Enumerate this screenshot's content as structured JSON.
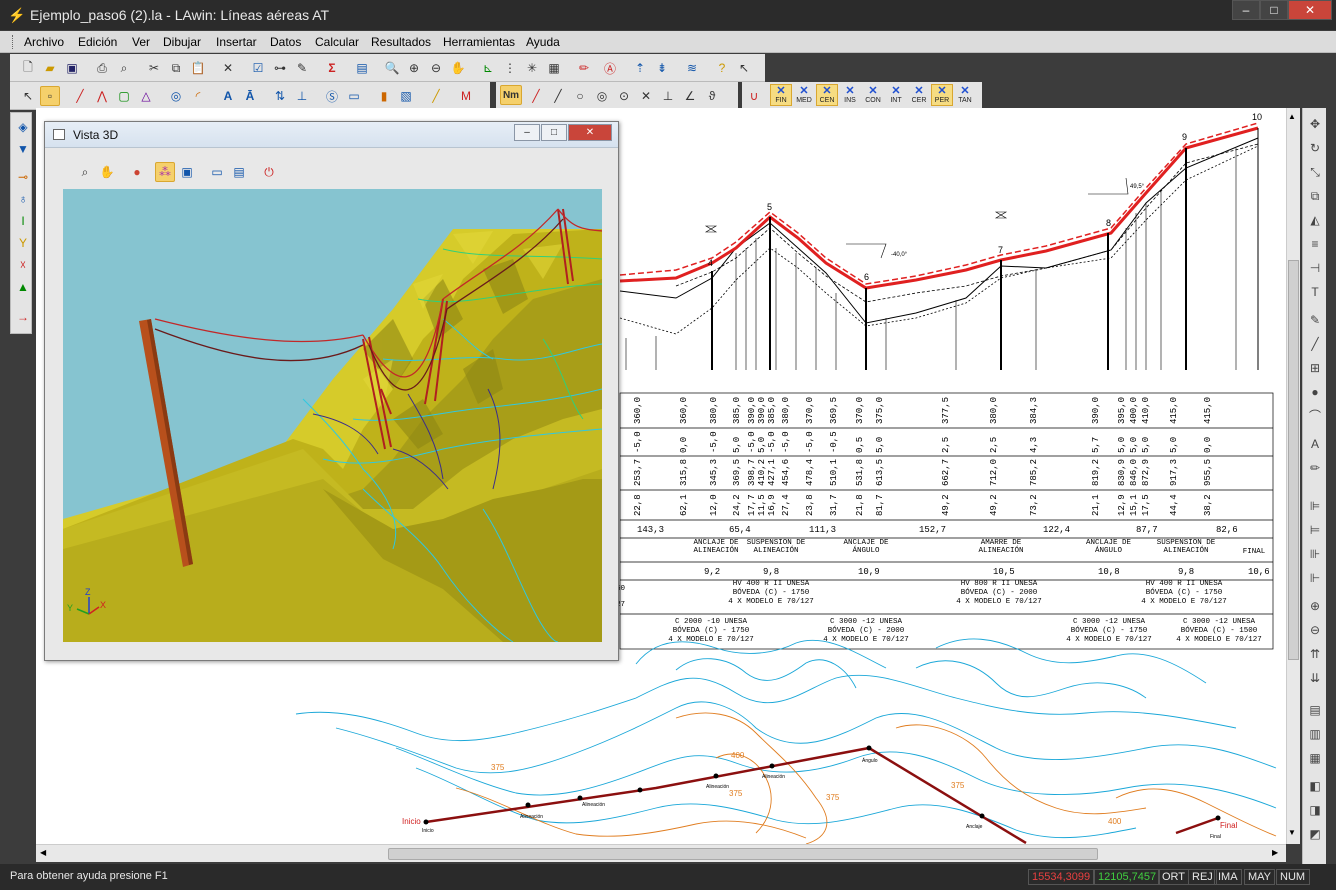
{
  "window": {
    "title": "Ejemplo_paso6 (2).la - LAwin: Líneas aéreas AT",
    "icon": "tower-icon",
    "controls": {
      "minimize": "–",
      "maximize": "□",
      "close": "✕"
    }
  },
  "menu": [
    "Archivo",
    "Edición",
    "Ver",
    "Dibujar",
    "Insertar",
    "Datos",
    "Calcular",
    "Resultados",
    "Herramientas",
    "Ayuda"
  ],
  "snap_toolbar": [
    {
      "label": "FIN",
      "active": true
    },
    {
      "label": "MED",
      "active": false
    },
    {
      "label": "CEN",
      "active": true
    },
    {
      "label": "INS",
      "active": false
    },
    {
      "label": "CON",
      "active": false
    },
    {
      "label": "INT",
      "active": false
    },
    {
      "label": "CER",
      "active": false
    },
    {
      "label": "PER",
      "active": true
    },
    {
      "label": "TAN",
      "active": false
    }
  ],
  "snap_mode_label": "Nm",
  "view3d": {
    "title": "Vista 3D",
    "axes": {
      "z": "Z",
      "y": "Y",
      "x": "X"
    },
    "colors": {
      "sky": "#86c4d0",
      "terrain": "#c8bc1e",
      "pole": "#b8501c",
      "conductor": "#d03030"
    }
  },
  "profile": {
    "support_numbers": [
      "4",
      "5",
      "6",
      "7",
      "8",
      "9",
      "10"
    ],
    "angle_labels": [
      "-40,0°",
      "49,5°"
    ],
    "table_row1": [
      "360,0",
      "360,0",
      "380,0",
      "385,0",
      "390,0",
      "390,0",
      "385,0",
      "380,0",
      "370,0",
      "369,5",
      "370,0",
      "375,0",
      "377,5",
      "380,0",
      "384,3",
      "390,0",
      "395,0",
      "400,0",
      "410,0",
      "415,0",
      "415,0"
    ],
    "table_row2": [
      "-5,0",
      "0,0",
      "-5,0",
      "5,0",
      "-5,0",
      "5,0",
      "-5,0",
      "-5,0",
      "-5,0",
      "-0,5",
      "0,5",
      "5,0",
      "2,5",
      "2,5",
      "4,3",
      "5,7",
      "5,0",
      "5,0",
      "5,0",
      "5,0",
      "0,0"
    ],
    "table_row3": [
      "253,7",
      "315,8",
      "345,3",
      "369,5",
      "398,7",
      "410,2",
      "427,1",
      "454,6",
      "478,4",
      "510,1",
      "531,8",
      "613,5",
      "662,7",
      "712,0",
      "785,2",
      "819,2",
      "830,9",
      "846,0",
      "872,9",
      "917,3",
      "955,5"
    ],
    "table_row4": [
      "22,8",
      "62,1",
      "12,0",
      "24,2",
      "17,7",
      "11,5",
      "16,9",
      "27,4",
      "23,8",
      "31,7",
      "21,8",
      "81,7",
      "49,2",
      "49,2",
      "73,2",
      "21,1",
      "12,9",
      "15,1",
      "17,5",
      "44,4",
      "38,2"
    ],
    "spans": [
      "143,3",
      "65,4",
      "111,3",
      "152,7",
      "122,4",
      "87,7",
      "82,6"
    ],
    "support_types": [
      "ANCLAJE DE ALINEACIÓN",
      "SUSPENSIÓN DE ALINEACIÓN",
      "ANCLAJE DE ÁNGULO",
      "AMARRE DE ALINEACIÓN",
      "ANCLAJE DE ÁNGULO",
      "SUSPENSIÓN DE ALINEACIÓN",
      "FINAL"
    ],
    "support_heights": [
      "9,2",
      "9,8",
      "10,9",
      "10,5",
      "10,8",
      "9,8",
      "10,6"
    ],
    "crossarms": [
      "HV 400 R II UNESA\nBÓVEDA (C) - 1750\n4 X MODELO E 70/127",
      "HV 800 R II UNESA\nBÓVEDA (C) - 2000\n4 X MODELO E 70/127",
      "HV 400 R II UNESA\nBÓVEDA (C) - 1750\n4 X MODELO E 70/127"
    ],
    "crossarms2": [
      "C 2000 -10 UNESA\nBÓVEDA (C) - 1750\n4 X MODELO E 70/127",
      "C 3000 -12 UNESA\nBÓVEDA (C) - 2000\n4 X MODELO E 70/127",
      "C 3000 -12 UNESA\nBÓVEDA (C) - 1750\n4 X MODELO E 70/127",
      "C 3000 -12 UNESA\nBÓVEDA (C) - 1500\n4 X MODELO E 70/127"
    ],
    "partial_left_labels": [
      "50",
      "27"
    ]
  },
  "plan": {
    "start_label": "Inicio",
    "end_label": "Final",
    "contour_labels": [
      "375",
      "375",
      "375",
      "400",
      "375",
      "400"
    ],
    "support_labels": [
      "Inicio",
      "Alineación",
      "Alineación",
      "Alineación",
      "Alineación",
      "Ángulo",
      "Anclaje",
      "Final"
    ]
  },
  "statusbar": {
    "help": "Para obtener ayuda presione F1",
    "coord_x": "15534,3099",
    "coord_y": "12105,7457",
    "flags": [
      "ORT",
      "REJ",
      "IMA",
      "MAY",
      "NUM"
    ]
  }
}
